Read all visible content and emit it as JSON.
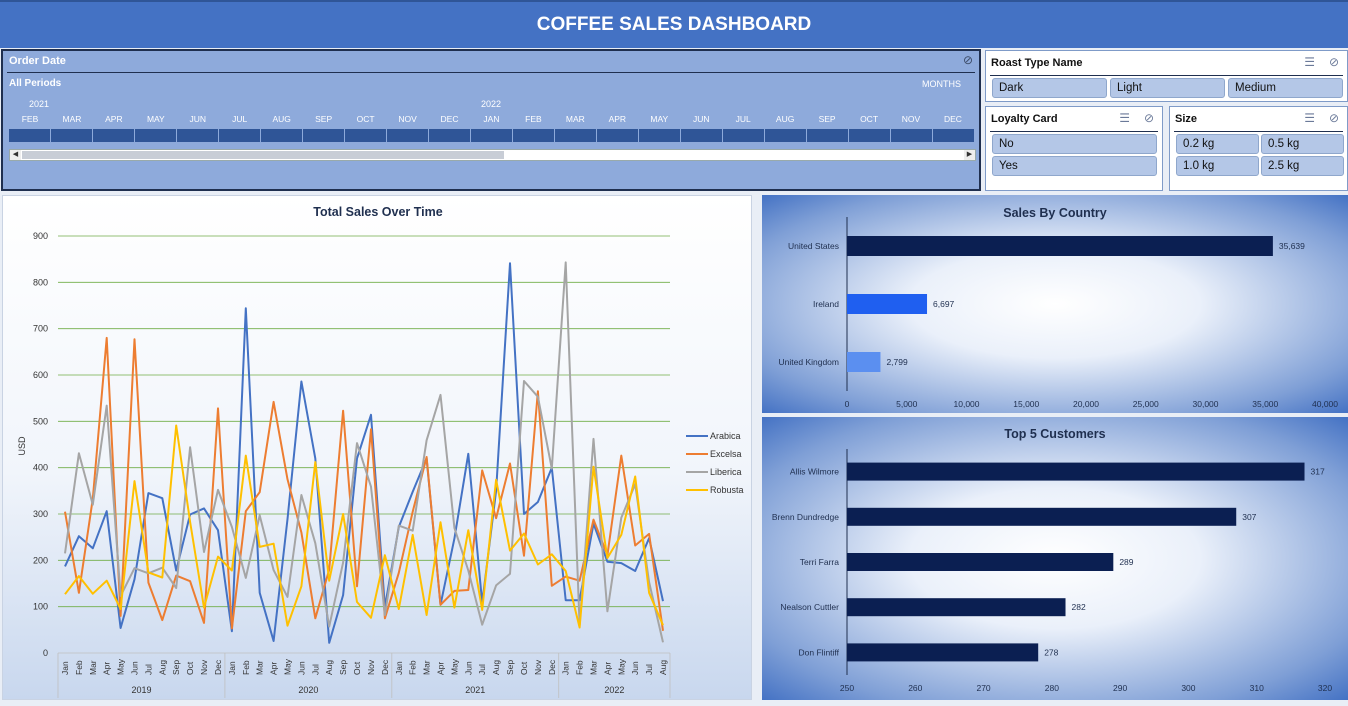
{
  "title": "COFFEE SALES DASHBOARD",
  "timeline": {
    "header": "Order Date",
    "periods": "All Periods",
    "unit": "MONTHS",
    "year_2021": "2021",
    "year_2022": "2022",
    "months": [
      "FEB",
      "MAR",
      "APR",
      "MAY",
      "JUN",
      "JUL",
      "AUG",
      "SEP",
      "OCT",
      "NOV",
      "DEC",
      "JAN",
      "FEB",
      "MAR",
      "APR",
      "MAY",
      "JUN",
      "JUL",
      "AUG",
      "SEP",
      "OCT",
      "NOV",
      "DEC"
    ]
  },
  "roast_slicer": {
    "header": "Roast Type Name",
    "items": [
      "Dark",
      "Light",
      "Medium"
    ]
  },
  "loyalty_slicer": {
    "header": "Loyalty Card",
    "items": [
      "No",
      "Yes"
    ]
  },
  "size_slicer": {
    "header": "Size",
    "items": [
      "0.2 kg",
      "0.5 kg",
      "1.0 kg",
      "2.5 kg"
    ]
  },
  "colors": {
    "arabica": "#4472c4",
    "excelsa": "#ed7d31",
    "liberica": "#a5a5a5",
    "robusta": "#ffc000",
    "navy": "#0b1f52",
    "grid": "#70ad47"
  },
  "chart_data": [
    {
      "type": "line",
      "title": "Total Sales Over Time",
      "ylabel": "USD",
      "ylim": [
        0,
        900
      ],
      "yticks": [
        0,
        100,
        200,
        300,
        400,
        500,
        600,
        700,
        800,
        900
      ],
      "months": [
        "Jan",
        "Feb",
        "Mar",
        "Apr",
        "May",
        "Jun",
        "Jul",
        "Aug",
        "Sep",
        "Oct",
        "Nov",
        "Dec",
        "Jan",
        "Feb",
        "Mar",
        "Apr",
        "May",
        "Jun",
        "Jul",
        "Aug",
        "Sep",
        "Oct",
        "Nov",
        "Dec",
        "Jan",
        "Feb",
        "Mar",
        "Apr",
        "May",
        "Jun",
        "Jul",
        "Aug",
        "Sep",
        "Oct",
        "Nov",
        "Dec",
        "Jan",
        "Feb",
        "Mar",
        "Apr",
        "May",
        "Jun",
        "Jul",
        "Aug"
      ],
      "years": [
        {
          "label": "2019",
          "count": 12
        },
        {
          "label": "2020",
          "count": 12
        },
        {
          "label": "2021",
          "count": 12
        },
        {
          "label": "2022",
          "count": 8
        }
      ],
      "series": [
        {
          "name": "Arabica",
          "color": "#4472c4",
          "values": [
            187,
            252,
            226,
            306,
            54,
            159,
            345,
            334,
            178,
            299,
            312,
            265,
            47,
            744,
            130,
            26,
            289,
            586,
            420,
            22,
            125,
            420,
            514,
            99,
            272,
            348,
            420,
            104,
            247,
            430,
            108,
            350,
            841,
            300,
            326,
            400,
            114,
            114,
            279,
            197,
            194,
            177,
            248,
            112
          ]
        },
        {
          "name": "Excelsa",
          "color": "#ed7d31",
          "values": [
            305,
            130,
            333,
            680,
            80,
            677,
            152,
            71,
            167,
            155,
            65,
            528,
            53,
            306,
            347,
            542,
            375,
            260,
            75,
            180,
            523,
            144,
            483,
            75,
            173,
            305,
            423,
            104,
            134,
            136,
            394,
            291,
            409,
            210,
            565,
            145,
            165,
            156,
            288,
            211,
            426,
            232,
            257,
            48
          ]
        },
        {
          "name": "Liberica",
          "color": "#a5a5a5",
          "values": [
            215,
            431,
            320,
            534,
            123,
            183,
            172,
            184,
            140,
            444,
            218,
            352,
            272,
            162,
            297,
            179,
            121,
            341,
            237,
            57,
            195,
            453,
            359,
            82,
            275,
            264,
            459,
            557,
            270,
            178,
            61,
            146,
            171,
            587,
            553,
            398,
            843,
            60,
            462,
            90,
            292,
            364,
            153,
            23
          ]
        },
        {
          "name": "Robusta",
          "color": "#ffc000",
          "values": [
            127,
            166,
            128,
            156,
            95,
            371,
            174,
            163,
            491,
            283,
            98,
            208,
            178,
            426,
            229,
            236,
            59,
            144,
            412,
            156,
            300,
            110,
            76,
            211,
            95,
            255,
            82,
            282,
            98,
            265,
            93,
            374,
            221,
            258,
            191,
            213,
            177,
            55,
            402,
            205,
            255,
            381,
            130,
            60
          ]
        }
      ]
    },
    {
      "type": "bar",
      "title": "Sales By Country",
      "categories": [
        "United States",
        "Ireland",
        "United Kingdom"
      ],
      "values": [
        35639,
        6697,
        2799
      ],
      "value_labels": [
        "35,639",
        "6,697",
        "2,799"
      ],
      "bar_colors": [
        "#0b1f52",
        "#1f5ff0",
        "#5b8ff0"
      ],
      "xlim": [
        0,
        40000
      ],
      "xticks": [
        "0",
        "5,000",
        "10,000",
        "15,000",
        "20,000",
        "25,000",
        "30,000",
        "35,000",
        "40,000"
      ]
    },
    {
      "type": "bar",
      "title": "Top 5 Customers",
      "categories": [
        "Allis Wilmore",
        "Brenn Dundredge",
        "Terri Farra",
        "Nealson Cuttler",
        "Don Flintiff"
      ],
      "values": [
        317,
        307,
        289,
        282,
        278
      ],
      "xlim": [
        250,
        320
      ],
      "xticks": [
        "250",
        "260",
        "270",
        "280",
        "290",
        "300",
        "310",
        "320"
      ]
    }
  ]
}
